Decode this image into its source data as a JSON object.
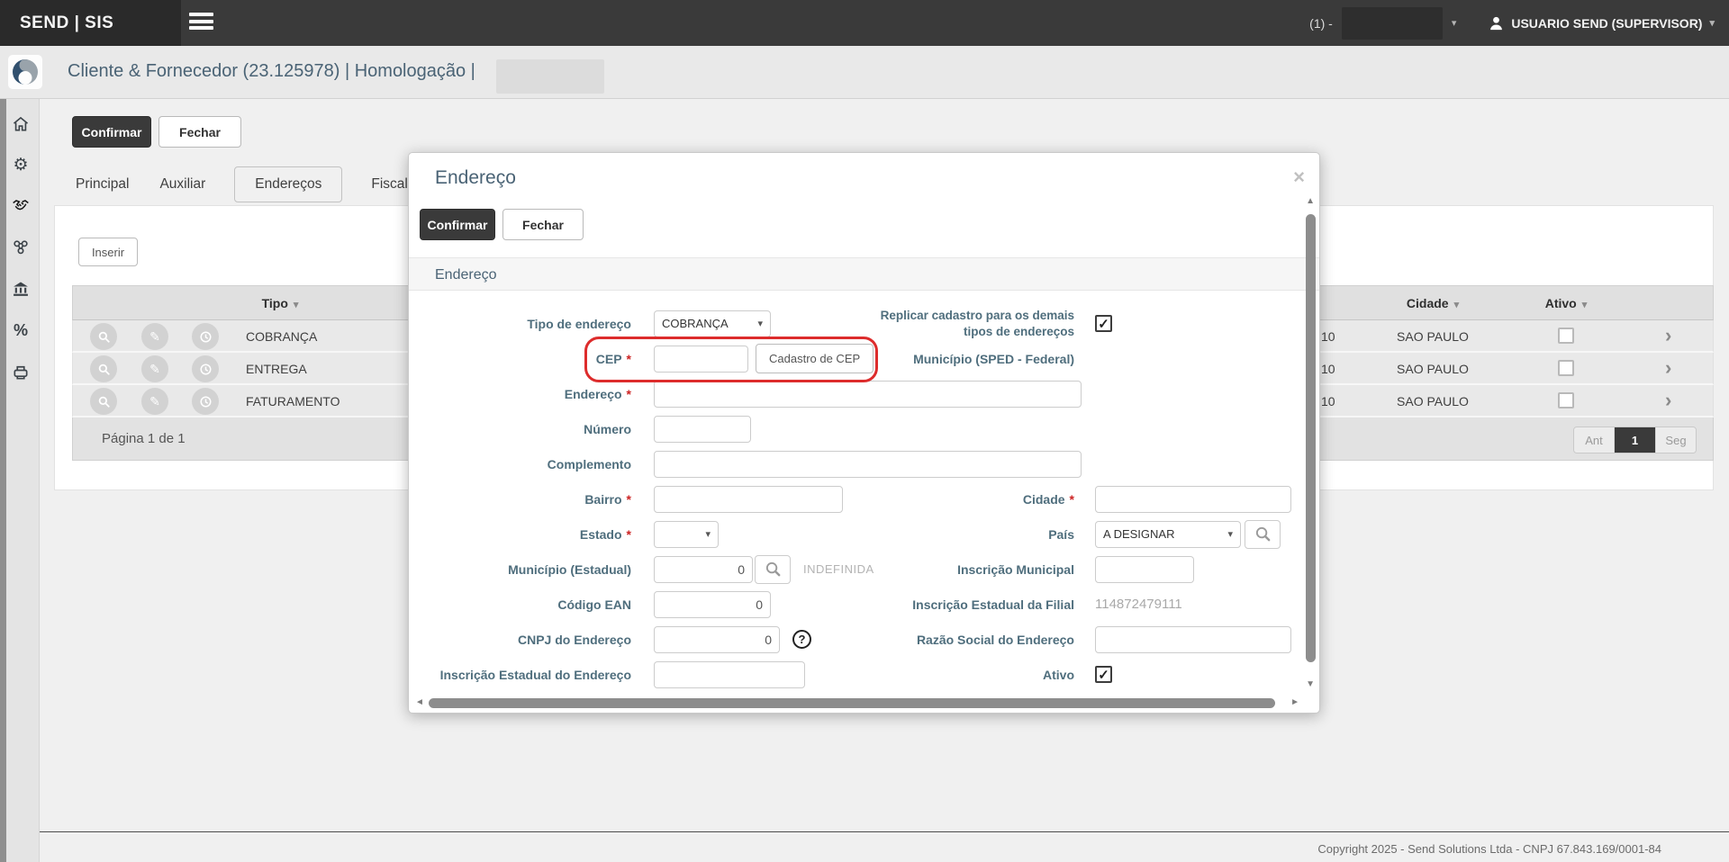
{
  "navbar": {
    "brand": "SEND | SIS",
    "company_prefix": "(1) -",
    "user_label": "USUARIO SEND (SUPERVISOR)"
  },
  "titlebar": {
    "title": "Cliente & Fornecedor (23.125978) | Homologação |"
  },
  "sidebar": {
    "icons": [
      "home",
      "settings",
      "partners",
      "network",
      "bank",
      "percent",
      "print"
    ]
  },
  "toolbar": {
    "confirm_label": "Confirmar",
    "close_label": "Fechar"
  },
  "tabs": [
    {
      "label": "Principal"
    },
    {
      "label": "Auxiliar"
    },
    {
      "label": "Endereços"
    },
    {
      "label": "Fiscal"
    }
  ],
  "active_tab": "Endereços",
  "table": {
    "insert_label": "Inserir",
    "columns": {
      "tipo": "Tipo",
      "cidade": "Cidade",
      "ativo": "Ativo"
    },
    "rows": [
      {
        "tipo": "COBRANÇA",
        "fragment": "10",
        "cidade": "SAO PAULO",
        "ativo": false
      },
      {
        "tipo": "ENTREGA",
        "fragment": "10",
        "cidade": "SAO PAULO",
        "ativo": false
      },
      {
        "tipo": "FATURAMENTO",
        "fragment": "10",
        "cidade": "SAO PAULO",
        "ativo": false
      }
    ],
    "footer_label": "Página 1 de 1",
    "pagination": {
      "prev": "Ant",
      "current": "1",
      "next": "Seg"
    }
  },
  "modal": {
    "title": "Endereço",
    "confirm_label": "Confirmar",
    "close_label": "Fechar",
    "section_title": "Endereço",
    "fields": {
      "tipo_endereco": {
        "label": "Tipo de endereço",
        "value": "COBRANÇA"
      },
      "replicar": {
        "label": "Replicar cadastro para os demais tipos de endereços",
        "checked": true
      },
      "cep": {
        "label": "CEP",
        "value": "",
        "button_label": "Cadastro de CEP"
      },
      "municipio_sped": {
        "label": "Município (SPED - Federal)"
      },
      "endereco": {
        "label": "Endereço",
        "value": ""
      },
      "numero": {
        "label": "Número",
        "value": ""
      },
      "complemento": {
        "label": "Complemento",
        "value": ""
      },
      "bairro": {
        "label": "Bairro",
        "value": ""
      },
      "cidade": {
        "label": "Cidade",
        "value": ""
      },
      "estado": {
        "label": "Estado",
        "value": ""
      },
      "pais": {
        "label": "País",
        "value": "A DESIGNAR"
      },
      "municipio_estadual": {
        "label": "Município (Estadual)",
        "value": "0",
        "status": "INDEFINIDA"
      },
      "inscricao_municipal": {
        "label": "Inscrição Municipal",
        "value": ""
      },
      "codigo_ean": {
        "label": "Código EAN",
        "value": "0"
      },
      "ie_filial": {
        "label": "Inscrição Estadual da Filial",
        "value": "114872479111"
      },
      "cnpj_endereco": {
        "label": "CNPJ do Endereço",
        "value": "0"
      },
      "razao_social": {
        "label": "Razão Social do Endereço",
        "value": ""
      },
      "ie_endereco": {
        "label": "Inscrição Estadual do Endereço",
        "value": ""
      },
      "ativo": {
        "label": "Ativo",
        "checked": true
      }
    }
  },
  "footer": {
    "copyright": "Copyright 2025 - Send Solutions Ltda - CNPJ 67.843.169/0001-84"
  },
  "glyphs": {
    "asterisk": "*",
    "check": "✓",
    "sort_caret": "▾",
    "select_caret": "▾",
    "chevron_right": "›",
    "close": "×",
    "dropdown_caret": "▾",
    "help": "?",
    "scroll_up": "▲",
    "scroll_down": "▼",
    "scroll_left": "◄",
    "scroll_right": "►",
    "pencil": "✎",
    "gear": "⚙",
    "home": "⌂",
    "percent": "%"
  },
  "colors": {
    "accent_dark": "#3a3a3a",
    "label": "#4f6e7d",
    "required": "#cc2222",
    "annotation": "#dd2c2c"
  }
}
